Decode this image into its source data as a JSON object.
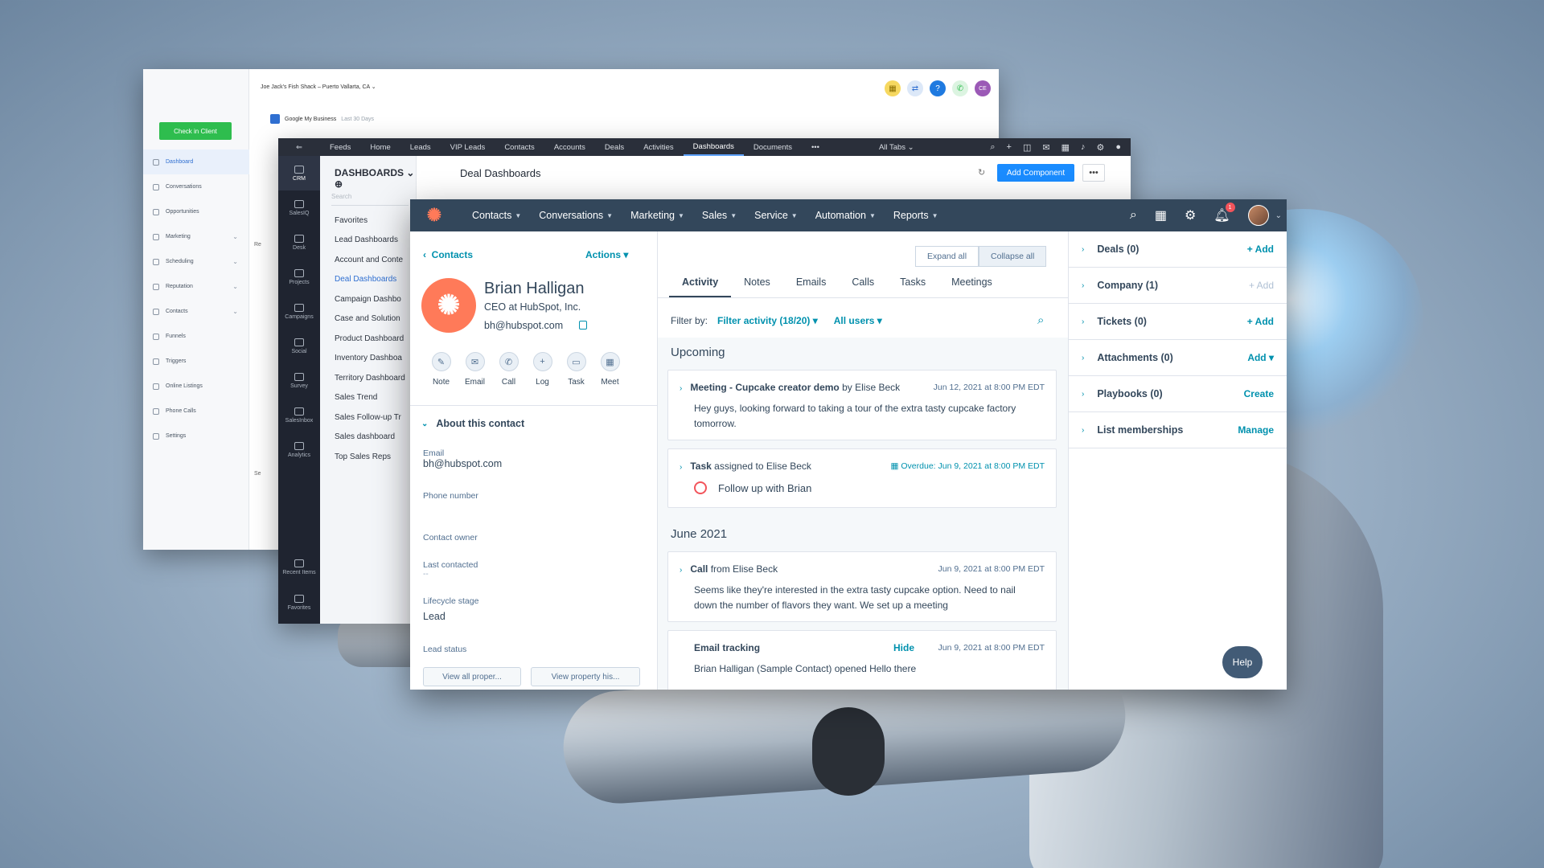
{
  "window1": {
    "location": "Joe Jack's Fish Shack – Puerto Vallarta, CA",
    "check_in_button": "Check in Client",
    "google_business": "Google My Business",
    "google_business_sub": "Last 30 Days",
    "nav": [
      "Dashboard",
      "Conversations",
      "Opportunities",
      "Marketing",
      "Scheduling",
      "Reputation",
      "Contacts",
      "Funnels",
      "Triggers",
      "Online Listings",
      "Phone Calls",
      "Settings"
    ],
    "partial_texts": [
      "Re",
      "Se"
    ],
    "avatar_initials": "CE"
  },
  "window2": {
    "tabs": [
      "Feeds",
      "Home",
      "Leads",
      "VIP Leads",
      "Contacts",
      "Accounts",
      "Deals",
      "Activities",
      "Dashboards",
      "Documents",
      "•••"
    ],
    "all_tabs": "All Tabs",
    "rail": [
      "CRM",
      "SalesIQ",
      "Desk",
      "Projects",
      "Campaigns",
      "Social",
      "Survey",
      "SalesInbox",
      "Analytics"
    ],
    "rail_bottom": [
      "Recent Items",
      "Favorites"
    ],
    "list_title": "DASHBOARDS",
    "search_placeholder": "Search",
    "list_items": [
      "Favorites",
      "Lead Dashboards",
      "Account and Conte",
      "Deal Dashboards",
      "Campaign Dashbo",
      "Case and Solution",
      "Product Dashboard",
      "Inventory Dashboa",
      "Territory Dashboard",
      "Sales Trend",
      "Sales Follow-up Tr",
      "Sales dashboard",
      "Top Sales Reps"
    ],
    "heading": "Deal Dashboards",
    "add_component": "Add Component",
    "more": "•••"
  },
  "hubspot": {
    "menu": [
      "Contacts",
      "Conversations",
      "Marketing",
      "Sales",
      "Service",
      "Automation",
      "Reports"
    ],
    "notification_count": "1",
    "breadcrumb": "Contacts",
    "actions": "Actions",
    "contact": {
      "name": "Brian Halligan",
      "title": "CEO at HubSpot, Inc.",
      "email": "bh@hubspot.com"
    },
    "quick_actions": [
      "Note",
      "Email",
      "Call",
      "Log",
      "Task",
      "Meet"
    ],
    "about_title": "About this contact",
    "properties": [
      {
        "label": "Email",
        "value": "bh@hubspot.com"
      },
      {
        "label": "Phone number",
        "value": ""
      },
      {
        "label": "Contact owner",
        "value": ""
      },
      {
        "label": "Last contacted",
        "value": "--"
      },
      {
        "label": "Lifecycle stage",
        "value": "Lead"
      },
      {
        "label": "Lead status",
        "value": ""
      }
    ],
    "view_all_button": "View all proper...",
    "view_history_button": "View property his...",
    "expand_all": "Expand all",
    "collapse_all": "Collapse all",
    "tabs": [
      "Activity",
      "Notes",
      "Emails",
      "Calls",
      "Tasks",
      "Meetings"
    ],
    "filter_label": "Filter by:",
    "filter_activity": "Filter activity (18/20)",
    "all_users": "All users",
    "upcoming_label": "Upcoming",
    "month_label": "June 2021",
    "meeting": {
      "title": "Meeting - Cupcake creator demo",
      "by": "by Elise Beck",
      "time": "Jun 12, 2021 at 8:00 PM EDT",
      "body": "Hey guys, looking forward to taking a tour of the extra tasty cupcake factory tomorrow."
    },
    "task": {
      "title": "Task",
      "assigned": "assigned to Elise Beck",
      "overdue": "Overdue: Jun 9, 2021 at 8:00 PM EDT",
      "body": "Follow up with Brian"
    },
    "call": {
      "title": "Call",
      "from": "from Elise Beck",
      "time": "Jun 9, 2021 at 8:00 PM EDT",
      "body": "Seems like they're interested in the extra tasty cupcake option. Need to nail down the number of flavors they want. We set up a meeting"
    },
    "email_tracking": {
      "title": "Email tracking",
      "hide": "Hide",
      "time": "Jun 9, 2021 at 8:00 PM EDT",
      "body": "Brian Halligan (Sample Contact) opened Hello there"
    },
    "sidebar": [
      {
        "label": "Deals (0)",
        "action": "+ Add"
      },
      {
        "label": "Company (1)",
        "action": "+ Add"
      },
      {
        "label": "Tickets (0)",
        "action": "+ Add"
      },
      {
        "label": "Attachments (0)",
        "action": "Add ▾"
      },
      {
        "label": "Playbooks (0)",
        "action": "Create"
      },
      {
        "label": "List memberships",
        "action": "Manage"
      }
    ],
    "help": "Help"
  }
}
